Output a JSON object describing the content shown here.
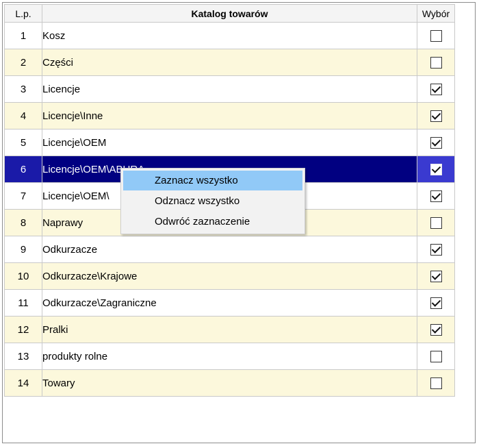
{
  "table": {
    "headers": {
      "lp": "L.p.",
      "name": "Katalog towarów",
      "select": "Wybór"
    },
    "rows": [
      {
        "lp": "1",
        "name": " Kosz",
        "checked": false
      },
      {
        "lp": "2",
        "name": "Części",
        "checked": false
      },
      {
        "lp": "3",
        "name": "Licencje",
        "checked": true
      },
      {
        "lp": "4",
        "name": "Licencje\\Inne",
        "checked": true
      },
      {
        "lp": "5",
        "name": "Licencje\\OEM",
        "checked": true
      },
      {
        "lp": "6",
        "name": "Licencje\\OEM\\ABURA",
        "checked": true,
        "selected": true
      },
      {
        "lp": "7",
        "name": "Licencje\\OEM\\",
        "checked": true
      },
      {
        "lp": "8",
        "name": "Naprawy",
        "checked": false
      },
      {
        "lp": "9",
        "name": "Odkurzacze",
        "checked": true
      },
      {
        "lp": "10",
        "name": "Odkurzacze\\Krajowe",
        "checked": true
      },
      {
        "lp": "11",
        "name": "Odkurzacze\\Zagraniczne",
        "checked": true
      },
      {
        "lp": "12",
        "name": "Pralki",
        "checked": true
      },
      {
        "lp": "13",
        "name": "produkty rolne",
        "checked": false
      },
      {
        "lp": "14",
        "name": "Towary",
        "checked": false
      }
    ]
  },
  "context_menu": {
    "items": [
      {
        "label": "Zaznacz wszystko",
        "hover": true
      },
      {
        "label": "Odznacz wszystko",
        "hover": false
      },
      {
        "label": "Odwróć zaznaczenie",
        "hover": false
      }
    ]
  },
  "colors": {
    "selected_row": "#010081",
    "alt_row": "#fcf8dc",
    "menu_hover": "#91c9f7"
  }
}
